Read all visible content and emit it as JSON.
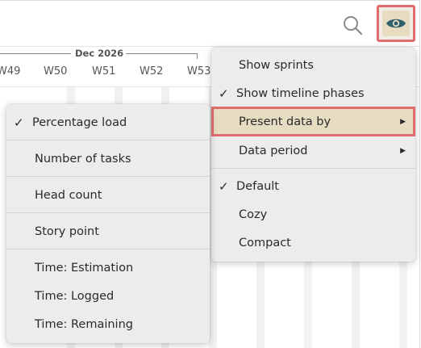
{
  "toolbar": {
    "search_icon": "search-icon",
    "view_icon": "eye-icon"
  },
  "timeline": {
    "month_label": "Dec 2026",
    "weeks": [
      "W49",
      "W50",
      "W51",
      "W52",
      "W53"
    ]
  },
  "view_menu": {
    "items": [
      {
        "label": "Show sprints",
        "checked": false
      },
      {
        "label": "Show timeline phases",
        "checked": true
      },
      {
        "label": "Present data by",
        "submenu": true,
        "highlighted": true
      },
      {
        "label": "Data period",
        "submenu": true
      },
      {
        "label": "Default",
        "checked": true
      },
      {
        "label": "Cozy",
        "checked": false
      },
      {
        "label": "Compact",
        "checked": false
      }
    ]
  },
  "present_data_menu": {
    "items": [
      {
        "label": "Percentage load",
        "checked": true
      },
      {
        "label": "Number of tasks"
      },
      {
        "label": "Head count"
      },
      {
        "label": "Story point"
      },
      {
        "label": "Time: Estimation"
      },
      {
        "label": "Time: Logged"
      },
      {
        "label": "Time: Remaining"
      }
    ]
  },
  "glyphs": {
    "check": "✓",
    "submenu_arrow": "▶"
  },
  "colors": {
    "highlight_border": "#e06d6d",
    "highlight_fill": "#e5dcc1",
    "menu_bg": "#ececec",
    "eye_icon": "#2f5f6a"
  }
}
